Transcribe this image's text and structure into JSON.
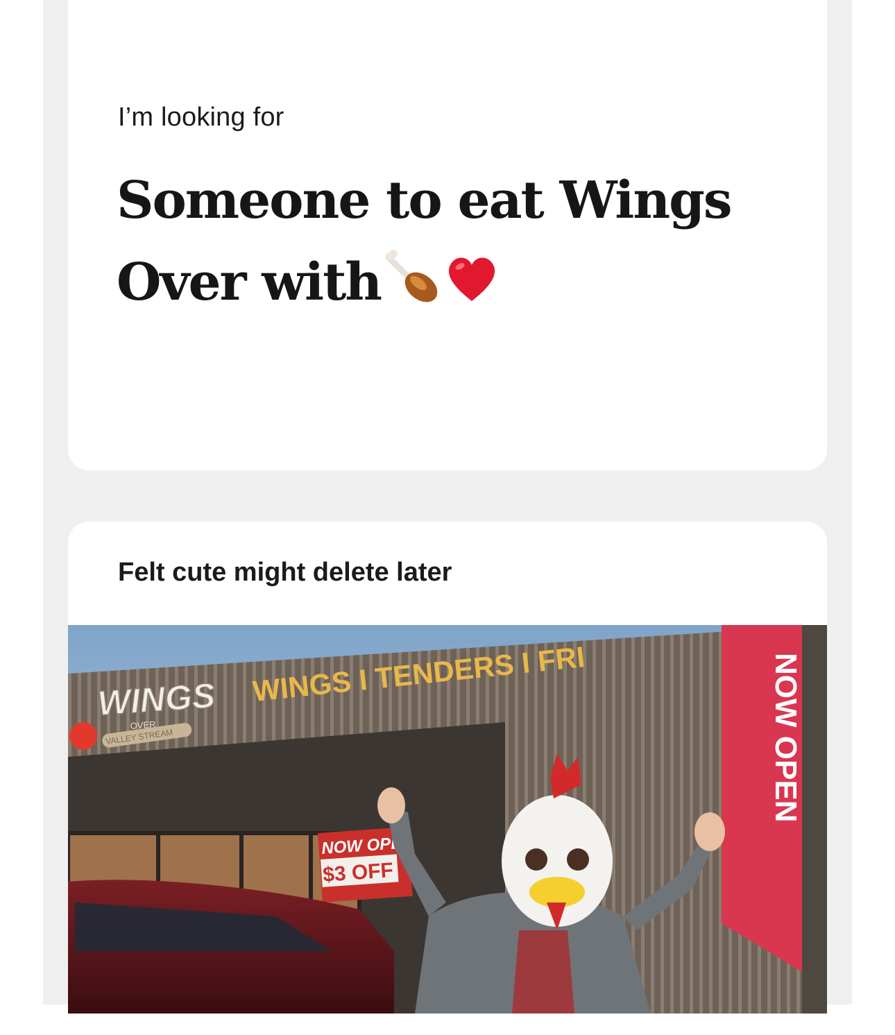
{
  "prompt_card": {
    "label": "I’m looking for",
    "answer": "Someone to eat Wings Over with",
    "emojis": [
      "poultry-leg-emoji",
      "red-heart-emoji"
    ]
  },
  "photo_card": {
    "caption": "Felt cute might delete later",
    "photo": {
      "logo_text": "WINGS",
      "logo_sub": "OVER",
      "logo_location": "VALLEY STREAM",
      "storefront_sign": "WINGS I TENDERS I FRI",
      "window_sign_line1": "NOW OPE",
      "window_sign_line2": "$3 OFF",
      "banner_text": "NOW OPEN"
    }
  },
  "colors": {
    "backdrop": "#efefef",
    "card": "#ffffff",
    "text": "#161616",
    "banner_red": "#d9364f",
    "sign_gold": "#e8b84a"
  }
}
